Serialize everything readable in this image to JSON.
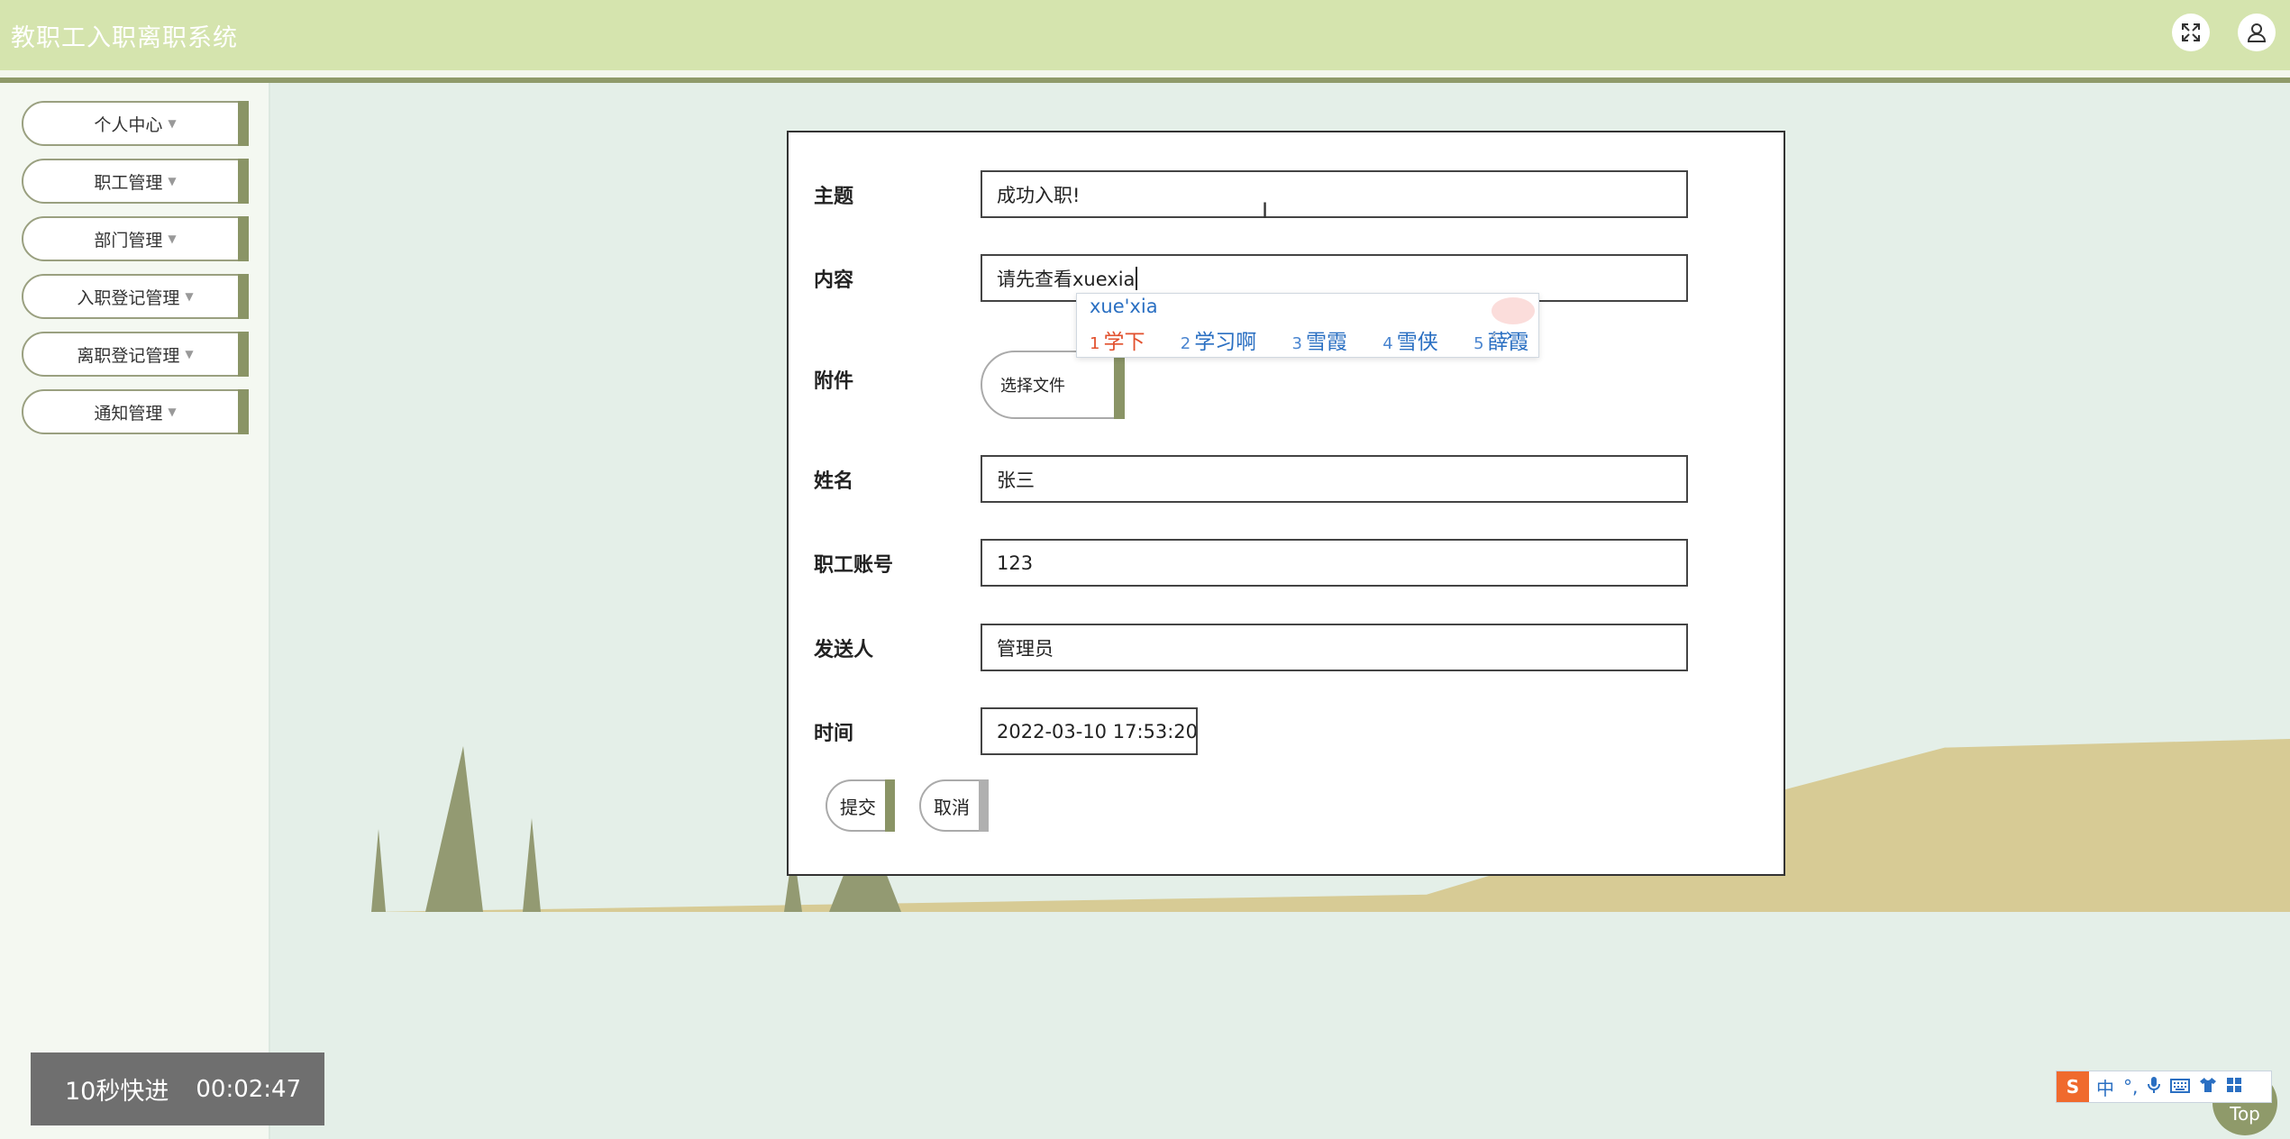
{
  "header": {
    "title": "教职工入职离职系统",
    "fullscreen_icon": "expand-icon",
    "user_icon": "user-icon"
  },
  "sidebar": {
    "items": [
      {
        "label": "个人中心"
      },
      {
        "label": "职工管理"
      },
      {
        "label": "部门管理"
      },
      {
        "label": "入职登记管理"
      },
      {
        "label": "离职登记管理"
      },
      {
        "label": "通知管理"
      }
    ]
  },
  "form": {
    "fields": {
      "subject": {
        "label": "主题",
        "value": "成功入职!"
      },
      "content": {
        "label": "内容",
        "value": "请先查看xuexia"
      },
      "attachment": {
        "label": "附件",
        "button": "选择文件"
      },
      "name": {
        "label": "姓名",
        "value": "张三"
      },
      "account": {
        "label": "职工账号",
        "value": "123"
      },
      "sender": {
        "label": "发送人",
        "value": "管理员"
      },
      "time": {
        "label": "时间",
        "value": "2022-03-10 17:53:20"
      }
    },
    "submit_label": "提交",
    "cancel_label": "取消"
  },
  "ime": {
    "composition": "xue'xia",
    "candidates": [
      {
        "n": "1",
        "text": "学下"
      },
      {
        "n": "2",
        "text": "学习啊"
      },
      {
        "n": "3",
        "text": "雪霞"
      },
      {
        "n": "4",
        "text": "雪侠"
      },
      {
        "n": "5",
        "text": "薛霞"
      }
    ],
    "prev": "‹",
    "next": "›",
    "bar": {
      "logo": "S",
      "mode": "中",
      "punct": "°,"
    }
  },
  "video": {
    "skip_label": "10秒快进",
    "time": "00:02:47"
  },
  "top_button": "Top",
  "colors": {
    "header_bg": "#d5e4ae",
    "accent": "#8a9466",
    "ime_text": "#2a6fc2",
    "ime_first": "#e2502d"
  }
}
